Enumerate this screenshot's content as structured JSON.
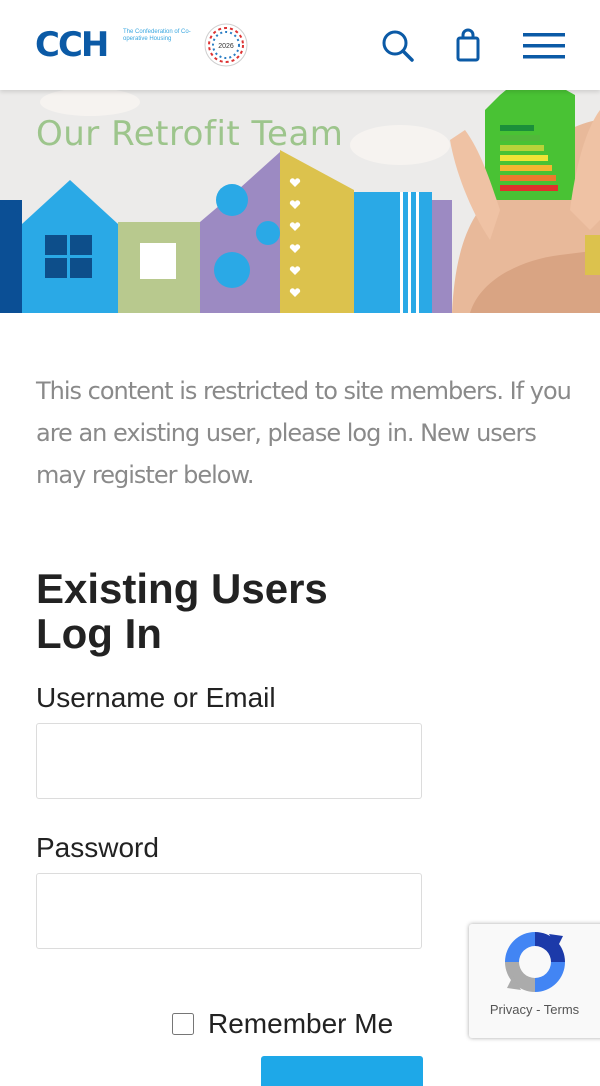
{
  "header": {
    "logo_text": "CCH",
    "logo_subtitle": "The Confederation of Co-operative Housing",
    "badge_text": "2026",
    "search_icon": "search-icon",
    "cart_icon": "shopping-bag-icon",
    "menu_icon": "hamburger-menu-icon",
    "brand_color": "#0b5aa6"
  },
  "hero": {
    "title": "Our Retrofit Team",
    "title_color": "#9dc58c"
  },
  "content": {
    "intro": "This content is restricted to site members. If you are an existing user, please log in. New users may register below."
  },
  "login": {
    "heading": "Existing Users Log In",
    "username_label": "Username or Email",
    "username_value": "",
    "password_label": "Password",
    "password_value": "",
    "remember_label": "Remember Me",
    "remember_checked": false,
    "submit_color": "#1ea8e8"
  },
  "recaptcha": {
    "privacy": "Privacy",
    "separator": " - ",
    "terms": "Terms"
  }
}
